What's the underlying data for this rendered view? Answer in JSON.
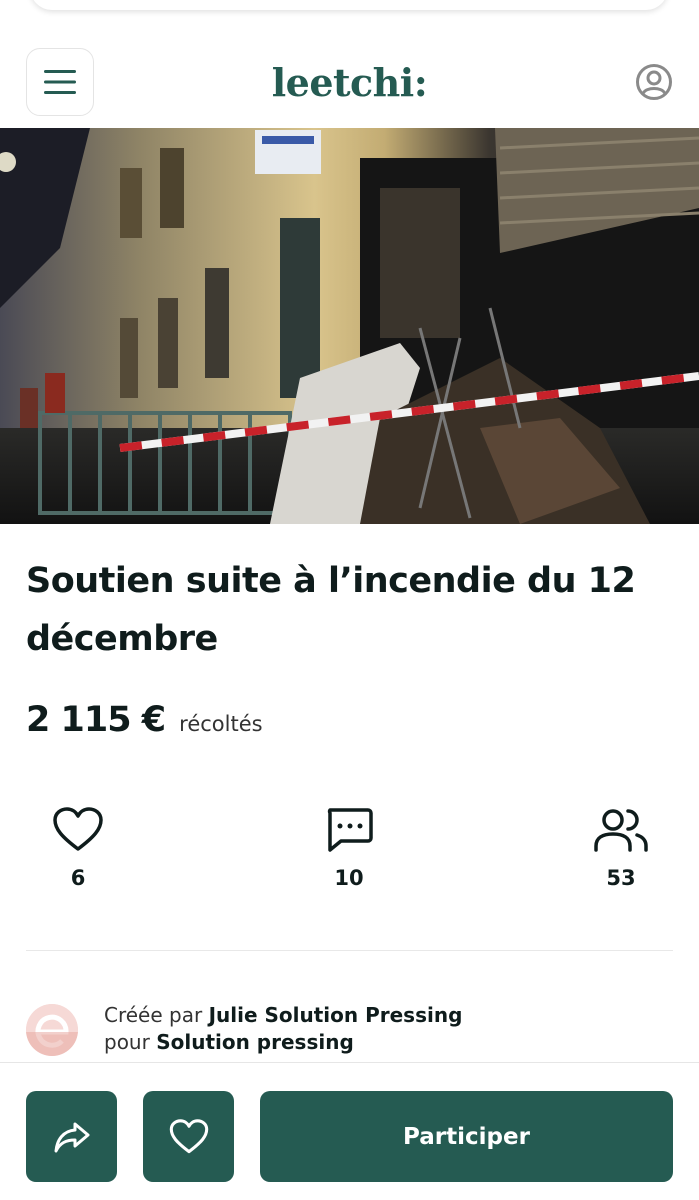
{
  "header": {
    "logo": "leetchi:",
    "menu_icon": "menu-icon",
    "account_icon": "user-circle-icon"
  },
  "hero": {
    "image": "photo of a burnt building facade at night with red and white barrier tape"
  },
  "campaign": {
    "title": "Soutien suite à l’incendie du 12 décembre",
    "amount": "2 115 €",
    "amount_label": "récoltés"
  },
  "stats": {
    "likes": {
      "icon": "heart-icon",
      "value": "6"
    },
    "comments": {
      "icon": "chat-bubble-icon",
      "value": "10"
    },
    "participants": {
      "icon": "users-icon",
      "value": "53"
    }
  },
  "creator": {
    "created_by_label": "Créée par",
    "creator_name": "Julie Solution Pressing",
    "for_label": "pour",
    "beneficiary": "Solution pressing"
  },
  "actions": {
    "share_icon": "share-icon",
    "favorite_icon": "heart-icon",
    "participate_label": "Participer"
  },
  "colors": {
    "brand": "#255b52",
    "text_dark": "#0f1c1c"
  }
}
